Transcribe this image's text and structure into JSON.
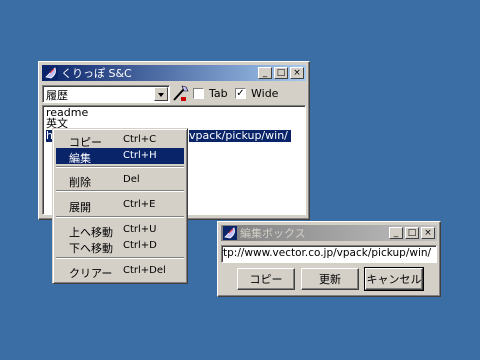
{
  "main_window": {
    "title": "くりっぽ S&C",
    "combo_value": "履歴",
    "tab_label": "Tab",
    "tab_checked": false,
    "wide_label": "Wide",
    "wide_checked": true,
    "checkmark": "✓",
    "list_items": [
      "readme",
      "英文",
      "h",
      "vpack/pickup/win/"
    ],
    "selected_item_index": 2
  },
  "title_buttons": {
    "minimize": "_",
    "maximize": "□",
    "close": "×"
  },
  "context_menu": {
    "items": [
      {
        "label": "コピー",
        "shortcut": "Ctrl+C"
      },
      {
        "label": "編集",
        "shortcut": "Ctrl+H"
      },
      {
        "label": "削除",
        "shortcut": "Del"
      },
      {
        "label": "展開",
        "shortcut": "Ctrl+E"
      },
      {
        "label": "上へ移動",
        "shortcut": "Ctrl+U"
      },
      {
        "label": "下へ移動",
        "shortcut": "Ctrl+D"
      },
      {
        "label": "クリアー",
        "shortcut": "Ctrl+Del"
      }
    ],
    "highlighted_index": 1
  },
  "edit_box": {
    "title": "編集ボックス",
    "input_value": "tp://www.vector.co.jp/vpack/pickup/win/",
    "copy_label": "コピー",
    "update_label": "更新",
    "cancel_label": "キャンセル"
  },
  "colors": {
    "desktop": "#3a6ea5",
    "face": "#d4d0c8",
    "active_title": "#0a246a",
    "highlight": "#0a246a"
  },
  "icons": {
    "app": "satellite-dish-icon",
    "tool": "wand-icon"
  }
}
